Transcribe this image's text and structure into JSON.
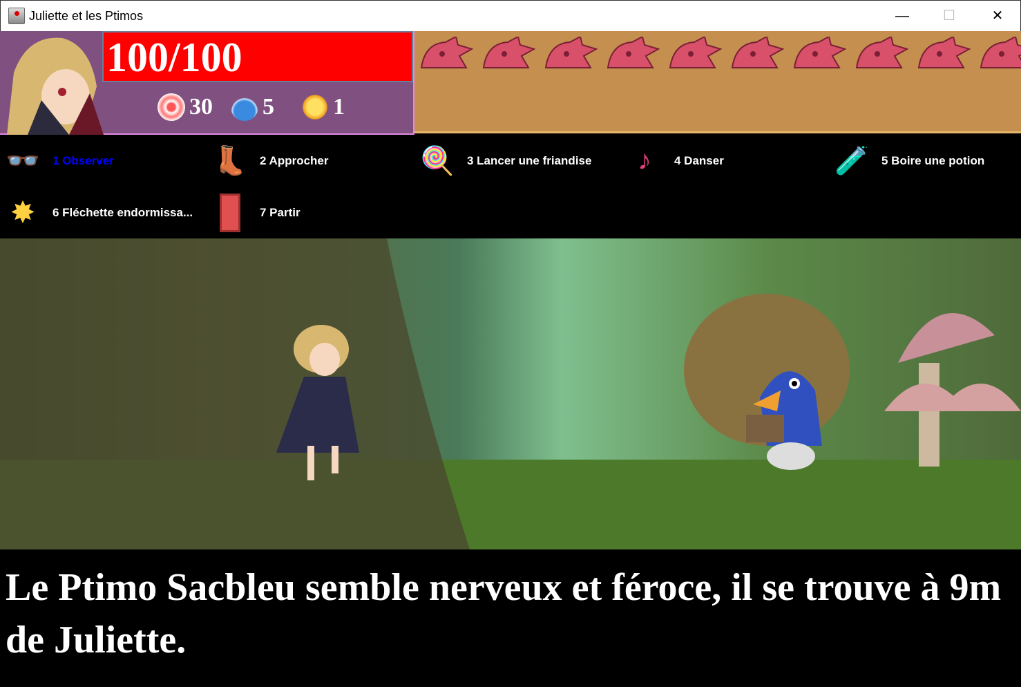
{
  "window": {
    "title": "Juliette et les Ptimos",
    "minimize": "—",
    "maximize": "☐",
    "close": "✕"
  },
  "hud": {
    "hp": "100/100",
    "inventory": [
      {
        "icon": "lollipop-icon",
        "count": "30"
      },
      {
        "icon": "potion-icon",
        "count": "5"
      },
      {
        "icon": "dart-icon",
        "count": "1"
      }
    ]
  },
  "enemies": {
    "count": 10
  },
  "actions": [
    {
      "label": "1 Observer",
      "icon": "glasses-icon",
      "color": "#0000ff"
    },
    {
      "label": "2 Approcher",
      "icon": "boots-icon"
    },
    {
      "label": "3 Lancer une friandise",
      "icon": "lollipop-icon"
    },
    {
      "label": "4 Danser",
      "icon": "music-note-icon"
    },
    {
      "label": "5 Boire une potion",
      "icon": "potion-icon"
    },
    {
      "label": "6 Fléchette endormissa...",
      "icon": "dart-icon"
    },
    {
      "label": "7 Partir",
      "icon": "door-icon"
    }
  ],
  "message": "Le Ptimo Sacbleu semble nerveux et féroce, il se trouve à 9m de Juliette."
}
